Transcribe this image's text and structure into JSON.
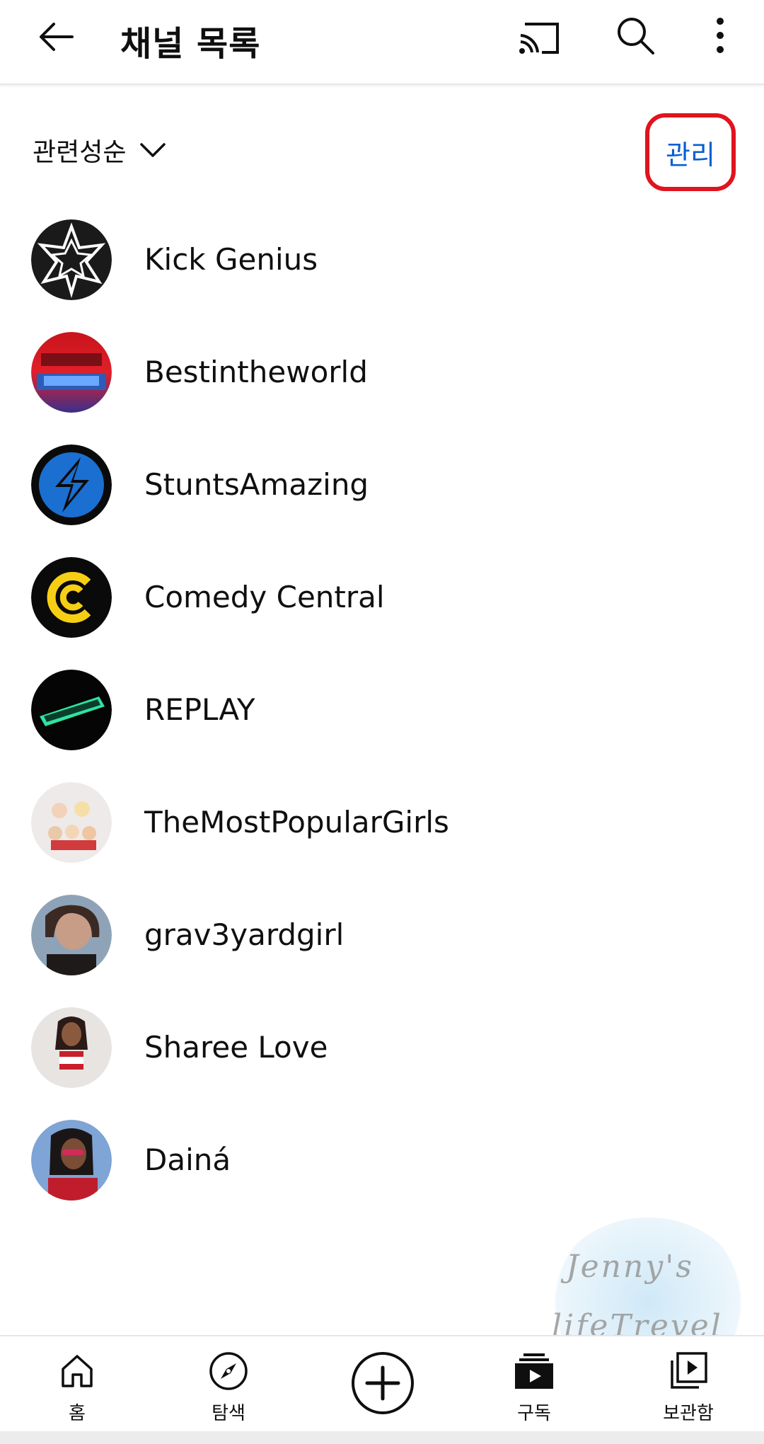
{
  "appbar": {
    "title": "채널 목록",
    "back_icon": "arrow-left-icon",
    "cast_icon": "cast-icon",
    "search_icon": "search-icon",
    "more_icon": "more-vert-icon"
  },
  "toolbar": {
    "sort_label": "관련성순",
    "manage_label": "관리",
    "manage_highlight_color": "#e0141f",
    "manage_text_color": "#065fd4"
  },
  "channels": [
    {
      "name": "Kick Genius"
    },
    {
      "name": "Bestintheworld"
    },
    {
      "name": "StuntsAmazing"
    },
    {
      "name": "Comedy Central"
    },
    {
      "name": "REPLAY"
    },
    {
      "name": "TheMostPopularGirls"
    },
    {
      "name": "grav3yardgirl"
    },
    {
      "name": "Sharee Love"
    },
    {
      "name": "Dainá"
    }
  ],
  "watermark": {
    "line1": "Jenny's",
    "line2": "lifeTrevel"
  },
  "bottom_nav": {
    "home": "홈",
    "explore": "탐색",
    "subscriptions": "구독",
    "library": "보관함"
  }
}
